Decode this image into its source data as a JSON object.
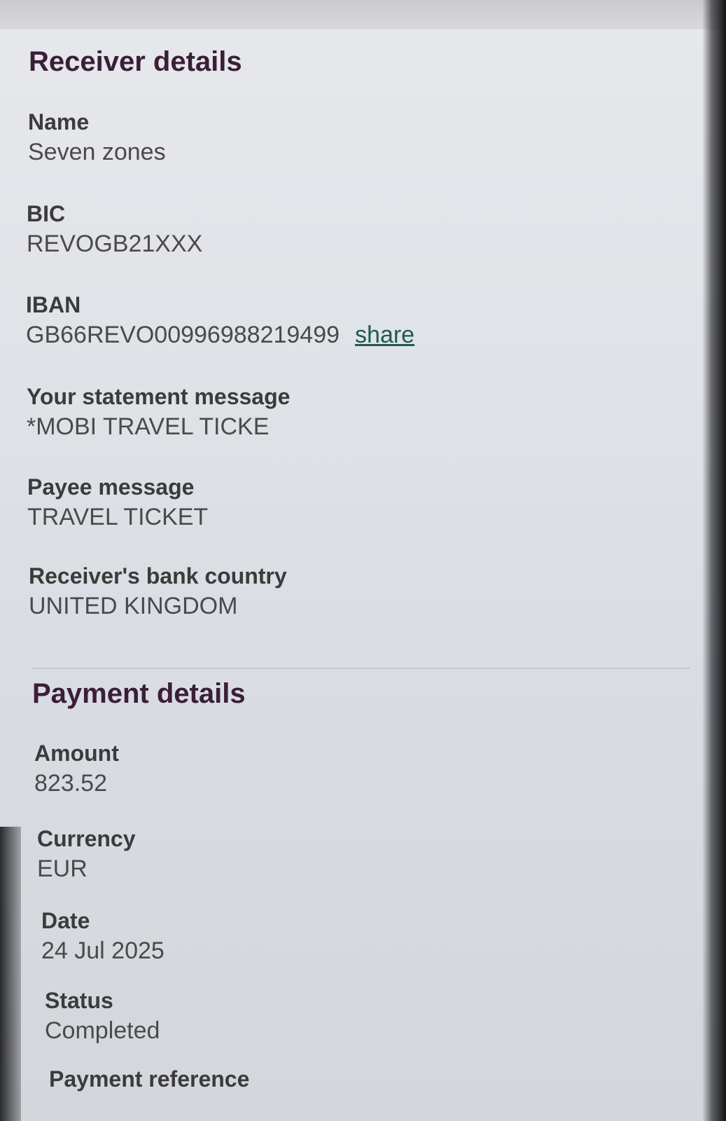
{
  "receiver": {
    "title": "Receiver details",
    "name_label": "Name",
    "name_value": "Seven zones",
    "bic_label": "BIC",
    "bic_value": "REVOGB21XXX",
    "iban_label": "IBAN",
    "iban_value": "GB66REVO00996988219499",
    "share_label": "share",
    "statement_label": "Your statement message",
    "statement_value": "*MOBI TRAVEL TICKE",
    "payee_label": "Payee message",
    "payee_value": "TRAVEL TICKET",
    "country_label": "Receiver's bank country",
    "country_value": "UNITED KINGDOM"
  },
  "payment": {
    "title": "Payment details",
    "amount_label": "Amount",
    "amount_value": "823.52",
    "currency_label": "Currency",
    "currency_value": "EUR",
    "date_label": "Date",
    "date_value": "24 Jul 2025",
    "status_label": "Status",
    "status_value": "Completed",
    "reference_label": "Payment reference"
  },
  "colors": {
    "title": "#3a1f36",
    "link": "#1e5a4e",
    "label": "#3b3b3b",
    "value": "#4a4a4a"
  }
}
